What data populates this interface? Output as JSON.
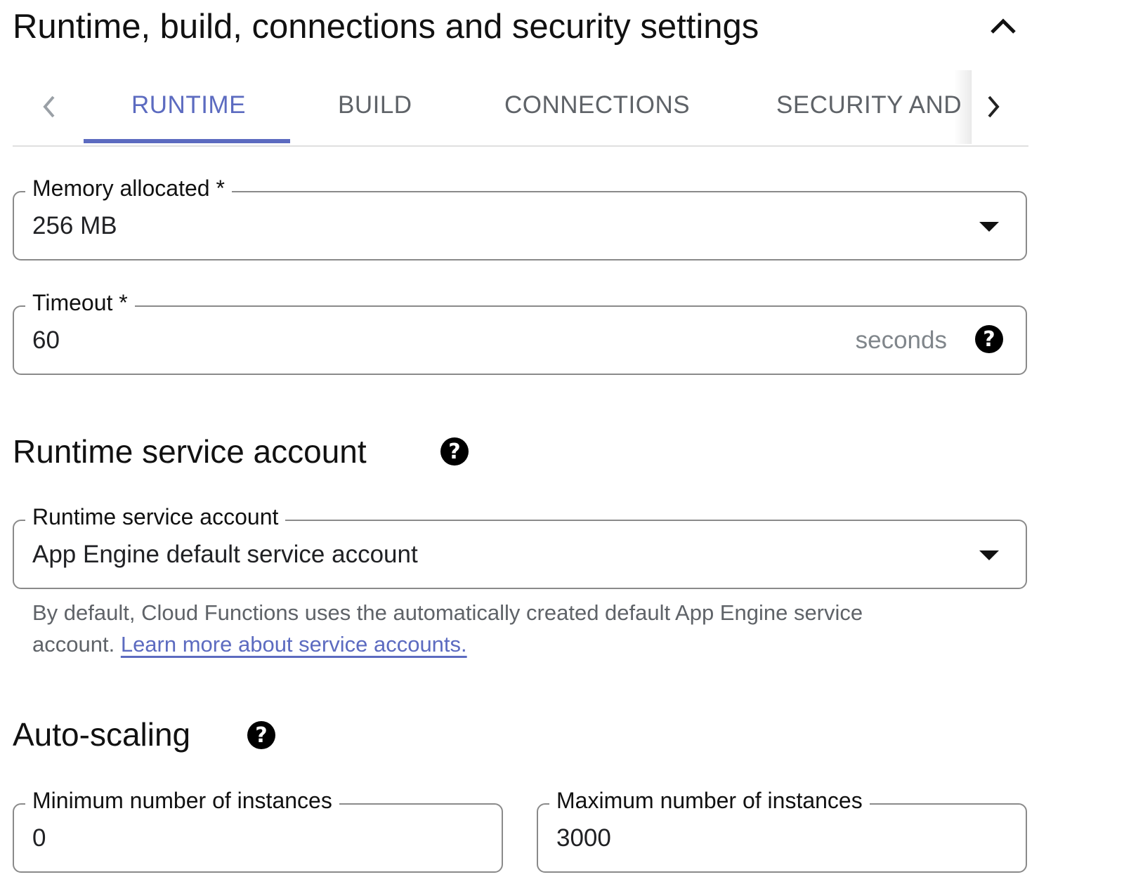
{
  "section": {
    "title": "Runtime, build, connections and security settings",
    "collapse_icon": "chevron-up-icon"
  },
  "tabs": {
    "items": [
      {
        "label": "RUNTIME",
        "active": true
      },
      {
        "label": "BUILD"
      },
      {
        "label": "CONNECTIONS"
      },
      {
        "label": "SECURITY AND"
      }
    ],
    "accent": "#5c6bc0"
  },
  "memory": {
    "label": "Memory allocated *",
    "value": "256 MB"
  },
  "timeout": {
    "label": "Timeout *",
    "value": "60",
    "suffix": "seconds"
  },
  "service_account": {
    "heading": "Runtime service account",
    "label": "Runtime service account",
    "value": "App Engine default service account",
    "hint": "By default, Cloud Functions uses the automatically created default App Engine service account.",
    "link": "Learn more about service accounts."
  },
  "autoscaling": {
    "heading": "Auto-scaling",
    "min_label": "Minimum number of instances",
    "min_value": "0",
    "max_label": "Maximum number of instances",
    "max_value": "3000"
  },
  "help_glyph": "?"
}
